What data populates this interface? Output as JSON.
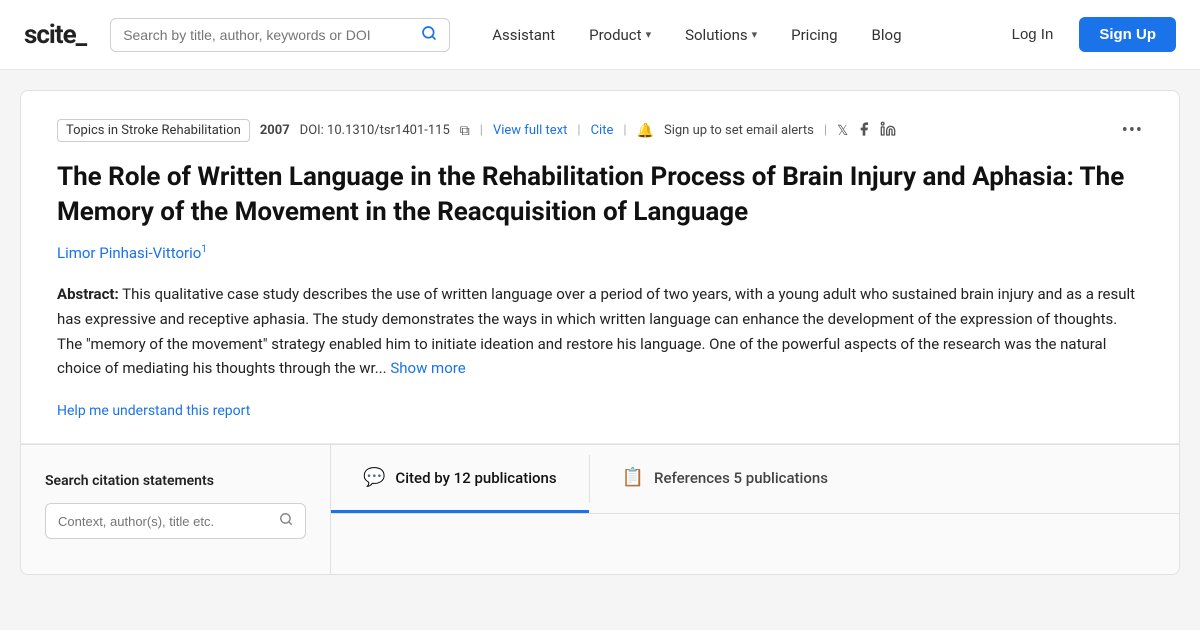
{
  "logo": {
    "text": "scite_"
  },
  "navbar": {
    "search_placeholder": "Search by title, author, keywords or DOI",
    "items": [
      {
        "label": "Assistant",
        "has_dropdown": false
      },
      {
        "label": "Product",
        "has_dropdown": true
      },
      {
        "label": "Solutions",
        "has_dropdown": true
      },
      {
        "label": "Pricing",
        "has_dropdown": false
      },
      {
        "label": "Blog",
        "has_dropdown": false
      }
    ],
    "login_label": "Log In",
    "signup_label": "Sign Up"
  },
  "article": {
    "journal": "Topics in Stroke Rehabilitation",
    "year": "2007",
    "doi": "DOI: 10.1310/tsr1401-115",
    "view_full_text": "View full text",
    "cite": "Cite",
    "alert_text": "Sign up to set email alerts",
    "title": "The Role of Written Language in the Rehabilitation Process of Brain Injury and Aphasia: The Memory of the Movement in the Reacquisition of Language",
    "author": "Limor Pinhasi-Vittorio",
    "author_sup": "1",
    "abstract_label": "Abstract:",
    "abstract_text": "This qualitative case study describes the use of written language over a period of two years, with a young adult who sustained brain injury and as a result has expressive and receptive aphasia. The study demonstrates the ways in which written language can enhance the development of the expression of thoughts. The \"memory of the movement\" strategy enabled him to initiate ideation and restore his language. One of the powerful aspects of the research was the natural choice of mediating his thoughts through the wr...",
    "show_more": "Show more",
    "help_link": "Help me understand this report"
  },
  "sidebar": {
    "title": "Search citation statements",
    "search_placeholder": "Context, author(s), title etc."
  },
  "tabs": [
    {
      "icon": "💬",
      "label": "Cited by 12 publications",
      "active": true
    },
    {
      "icon": "📋",
      "label": "References 5 publications",
      "active": false
    }
  ]
}
